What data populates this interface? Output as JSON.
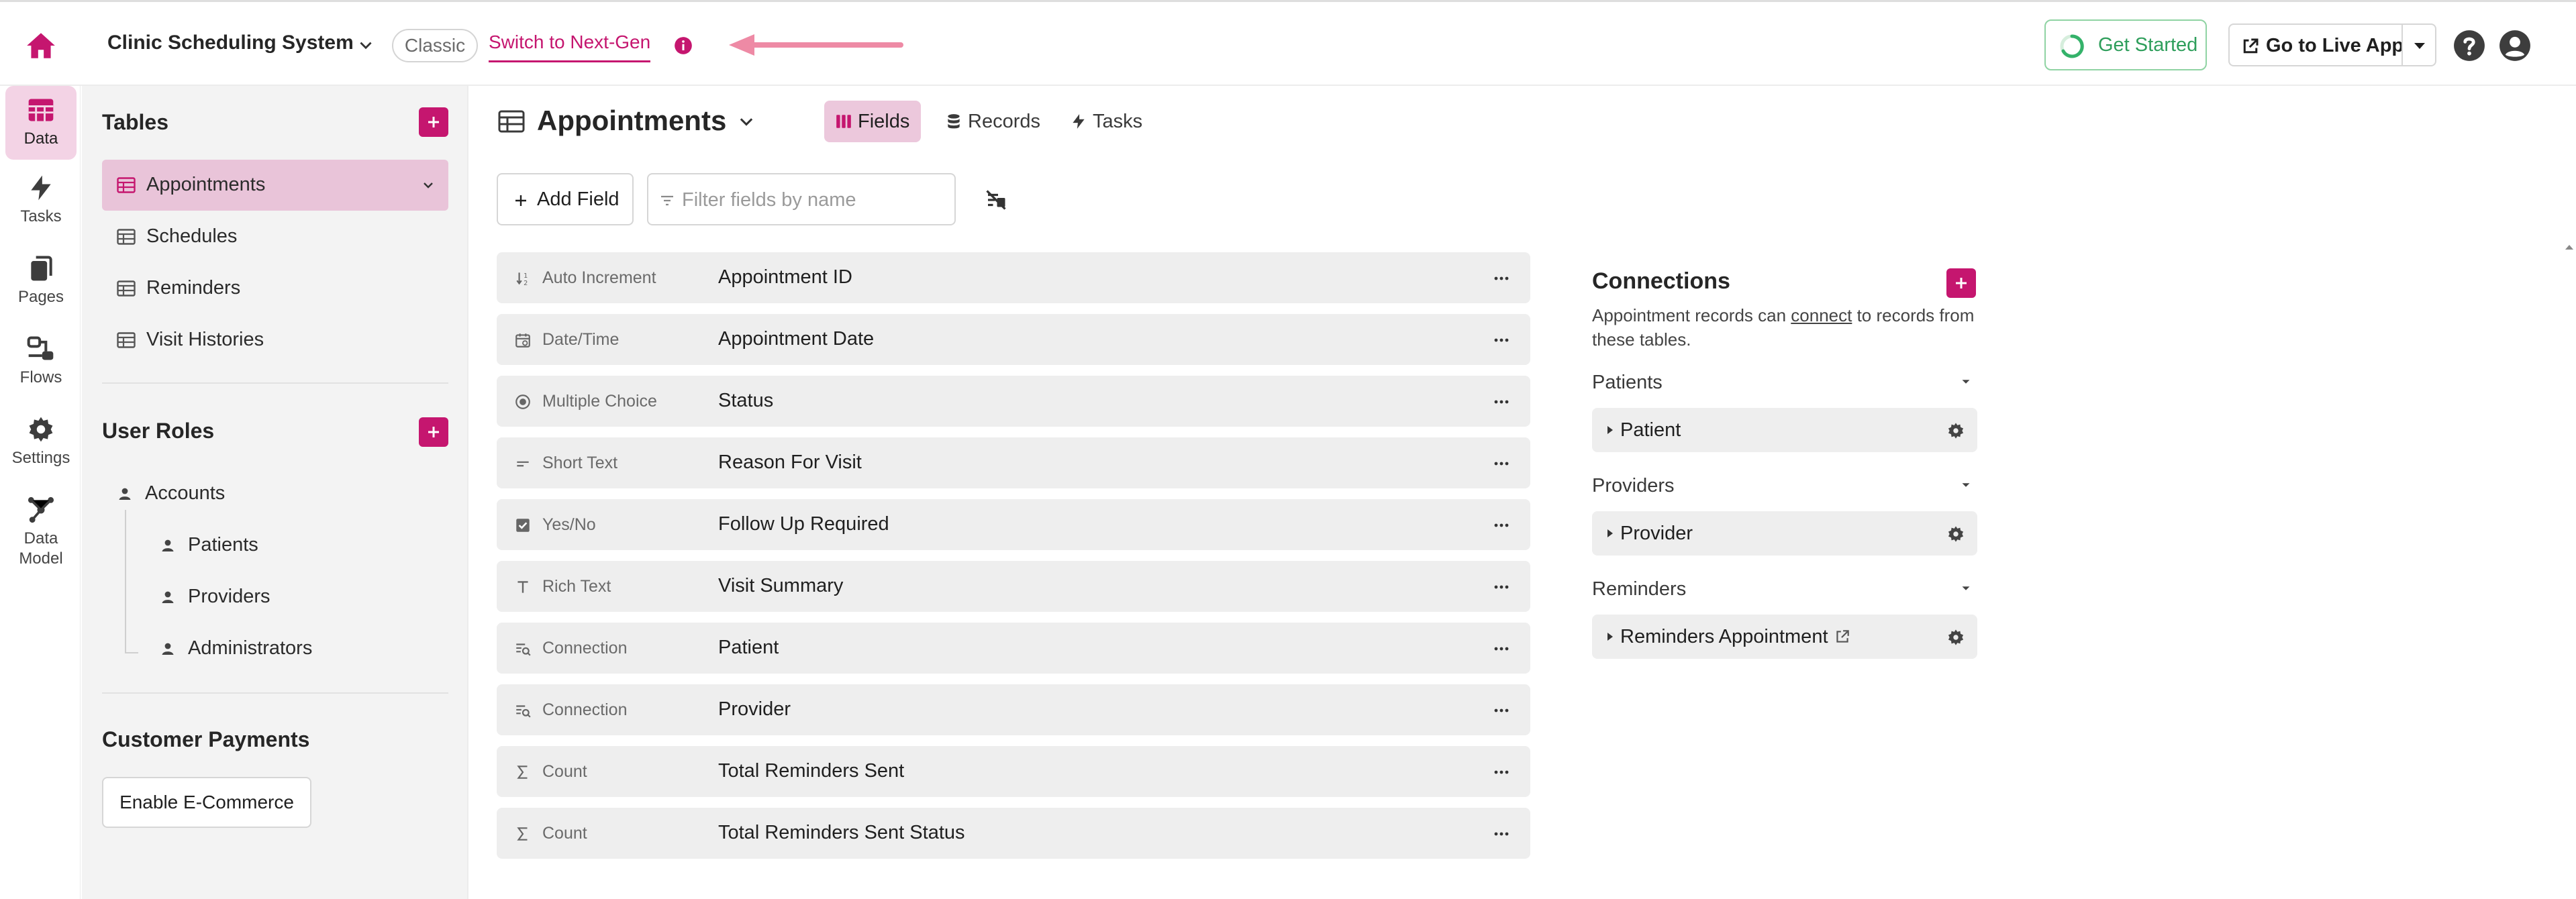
{
  "topbar": {
    "app_title": "Clinic Scheduling System",
    "classic_label": "Classic",
    "nextgen_label": "Switch to Next-Gen",
    "get_started_label": "Get Started",
    "live_app_label": "Go to Live App"
  },
  "rail": {
    "items": [
      {
        "label": "Data",
        "icon": "table-icon",
        "active": true
      },
      {
        "label": "Tasks",
        "icon": "bolt-icon"
      },
      {
        "label": "Pages",
        "icon": "pages-icon"
      },
      {
        "label": "Flows",
        "icon": "flows-icon"
      },
      {
        "label": "Settings",
        "icon": "gear-icon"
      },
      {
        "label": "Data Model",
        "icon": "data-model-icon"
      }
    ]
  },
  "tables_panel": {
    "tables_title": "Tables",
    "tables": [
      "Appointments",
      "Schedules",
      "Reminders",
      "Visit Histories"
    ],
    "user_roles_title": "User Roles",
    "accounts_label": "Accounts",
    "roles": [
      "Patients",
      "Providers",
      "Administrators"
    ],
    "payments_title": "Customer Payments",
    "ecommerce_label": "Enable E-Commerce"
  },
  "main": {
    "title": "Appointments",
    "tabs": [
      "Fields",
      "Records",
      "Tasks"
    ],
    "add_field_label": "Add Field",
    "filter_placeholder": "Filter fields by name",
    "fields": [
      {
        "type": "Auto Increment",
        "name": "Appointment ID",
        "icon": "auto-increment-icon"
      },
      {
        "type": "Date/Time",
        "name": "Appointment Date",
        "icon": "calendar-icon"
      },
      {
        "type": "Multiple Choice",
        "name": "Status",
        "icon": "radio-icon"
      },
      {
        "type": "Short Text",
        "name": "Reason For Visit",
        "icon": "short-text-icon"
      },
      {
        "type": "Yes/No",
        "name": "Follow Up Required",
        "icon": "checkbox-icon"
      },
      {
        "type": "Rich Text",
        "name": "Visit Summary",
        "icon": "rich-text-icon"
      },
      {
        "type": "Connection",
        "name": "Patient",
        "icon": "connection-icon"
      },
      {
        "type": "Connection",
        "name": "Provider",
        "icon": "connection-icon"
      },
      {
        "type": "Count",
        "name": "Total Reminders Sent",
        "icon": "sigma-icon"
      },
      {
        "type": "Count",
        "name": "Total Reminders Sent Status",
        "icon": "sigma-icon"
      }
    ]
  },
  "connections": {
    "title": "Connections",
    "desc_before": "Appointment records can ",
    "desc_link": "connect",
    "desc_after": " to records from these tables.",
    "groups": [
      {
        "name": "Patients",
        "item": "Patient"
      },
      {
        "name": "Providers",
        "item": "Provider"
      },
      {
        "name": "Reminders",
        "item": "Reminders Appointment"
      }
    ]
  },
  "colors": {
    "accent": "#c5166f",
    "accent_soft": "#e9c4d9",
    "success": "#2e9e5b",
    "panel_bg": "#f3f3f3",
    "row_bg": "#eeeeee"
  }
}
